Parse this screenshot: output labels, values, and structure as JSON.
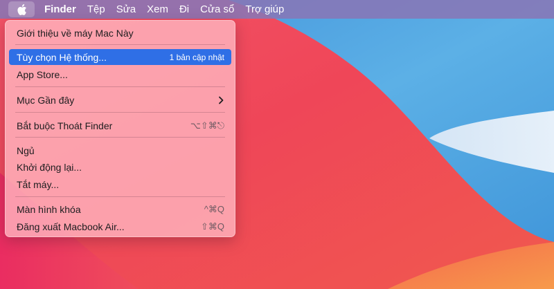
{
  "menubar": {
    "apple_icon": "apple-logo-icon",
    "items": [
      "Finder",
      "Tệp",
      "Sửa",
      "Xem",
      "Đi",
      "Cửa sổ",
      "Trợ giúp"
    ]
  },
  "apple_menu": {
    "about": "Giới thiệu về máy Mac Này",
    "system_preferences": "Tùy chọn Hệ thống...",
    "update_badge": "1 bản cập nhật",
    "app_store": "App Store...",
    "recent_items": "Mục Gần đây",
    "force_quit": "Bắt buộc Thoát Finder",
    "force_quit_shortcut": "⌥⇧⌘⎋",
    "sleep": "Ngủ",
    "restart": "Khởi động lại...",
    "shut_down": "Tắt máy...",
    "lock_screen": "Màn hình khóa",
    "lock_screen_shortcut": "^⌘Q",
    "log_out": "Đăng xuất Macbook Air...",
    "log_out_shortcut": "⇧⌘Q"
  },
  "colors": {
    "highlight": "#2f6fe6",
    "menubar": "#8776b6",
    "wallpaper_red": "#ef4a5a",
    "wallpaper_blue": "#4aa6e2"
  }
}
